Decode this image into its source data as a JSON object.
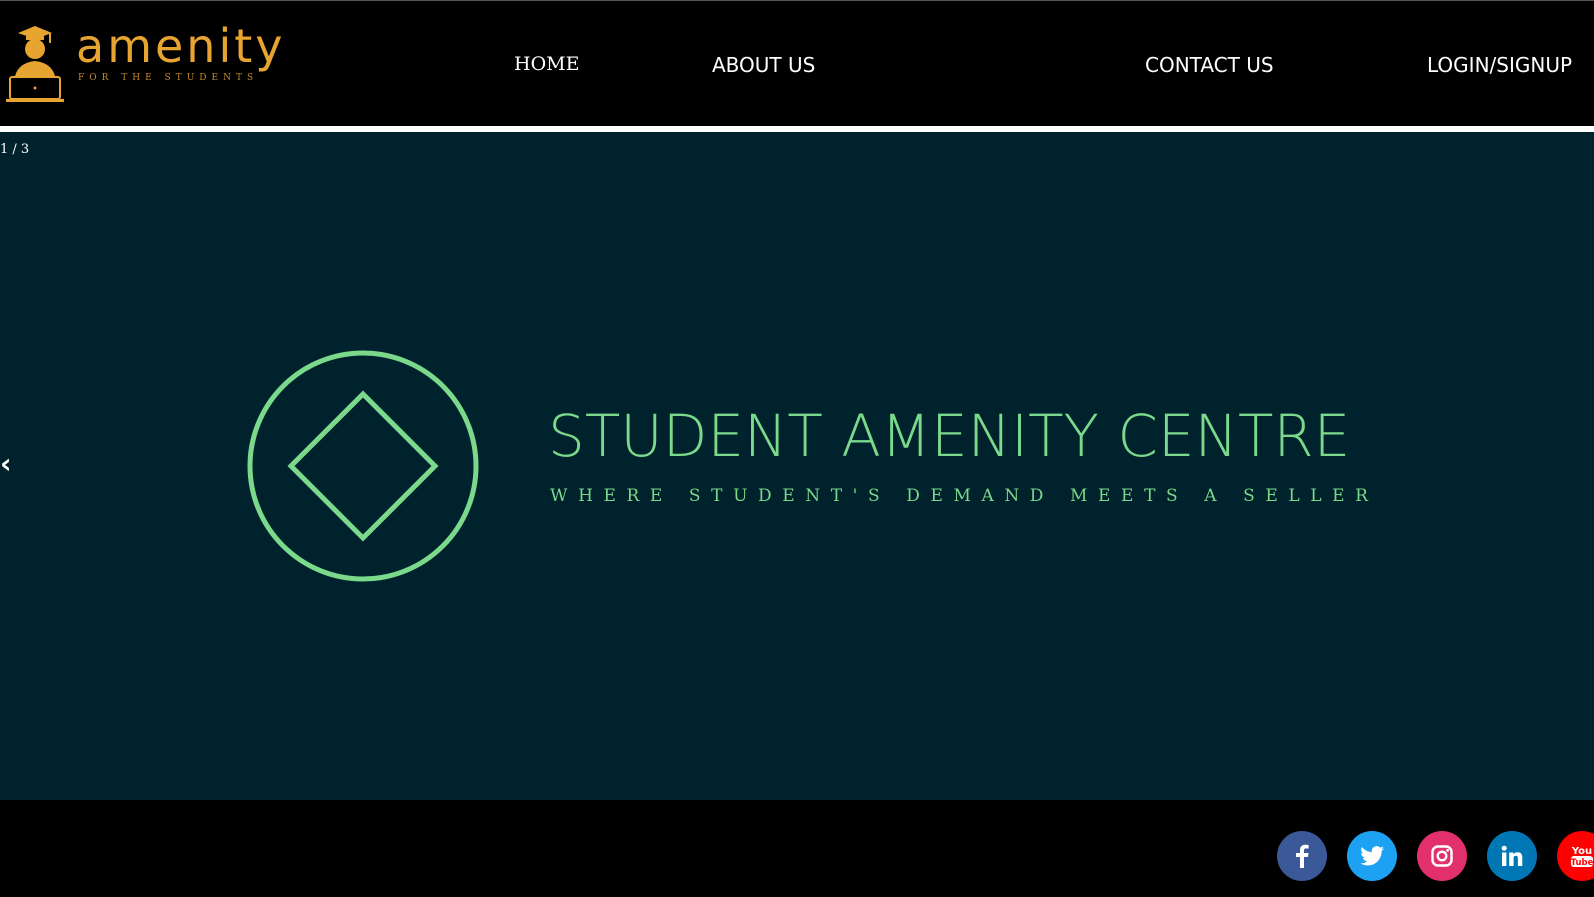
{
  "header": {
    "logo": {
      "wordmark": "amenity",
      "tagline": "FOR THE STUDENTS",
      "color": "#e7a430"
    },
    "nav": {
      "home": "HOME",
      "about": "ABOUT US",
      "contact": "CONTACT US",
      "login": "LOGIN/SIGNUP"
    }
  },
  "slideshow": {
    "counter": "1 / 3",
    "prev_symbol": "‹",
    "background": "#00222d",
    "accent": "#7ad98a",
    "title": "STUDENT AMENITY CENTRE",
    "tagline": "WHERE STUDENT'S DEMAND MEETS A SELLER"
  },
  "footer": {
    "social": [
      {
        "icon": "facebook-icon",
        "color": "#3b5998"
      },
      {
        "icon": "twitter-icon",
        "color": "#1da1f2"
      },
      {
        "icon": "instagram-icon",
        "color": "#e1306c"
      },
      {
        "icon": "linkedin-icon",
        "color": "#0077b5"
      },
      {
        "icon": "youtube-icon",
        "color": "#ff0000",
        "text": "You Tube"
      }
    ]
  }
}
